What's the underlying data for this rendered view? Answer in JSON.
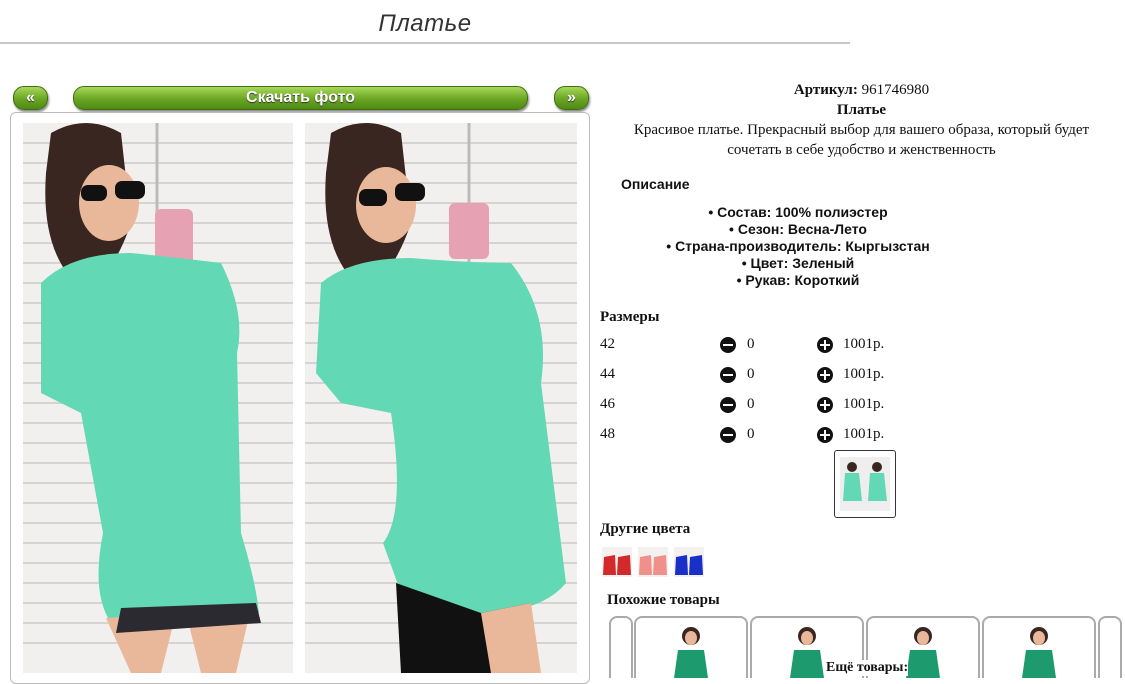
{
  "page": {
    "title": "Платье"
  },
  "nav": {
    "prev_label": "«",
    "download_label": "Скачать фото",
    "next_label": "»"
  },
  "product": {
    "article_label": "Артикул:",
    "article_value": "961746980",
    "name": "Платье",
    "description": "Красивое платье. Прекрасный выбор для вашего образа, который будет сочетать в себе удобство и женственность",
    "specs_title": "Описание",
    "specs": [
      "Состав: 100% полиэстер",
      "Сезон: Весна-Лето",
      "Страна-производитель: Кыргызстан",
      "Цвет: Зеленый",
      "Рукав: Короткий"
    ]
  },
  "sizes": {
    "title": "Размеры",
    "rows": [
      {
        "size": "42",
        "qty": "0",
        "price": "1001р."
      },
      {
        "size": "44",
        "qty": "0",
        "price": "1001р."
      },
      {
        "size": "46",
        "qty": "0",
        "price": "1001р."
      },
      {
        "size": "48",
        "qty": "0",
        "price": "1001р."
      }
    ]
  },
  "other_colors": {
    "title": "Другие цвета",
    "swatches": [
      "#d22a2a",
      "#f0908a",
      "#1a2ec8"
    ]
  },
  "similar": {
    "title": "Похожие товары",
    "more_label": "Ещё товары:"
  },
  "colors": {
    "dress": "#62d9b4",
    "button_green": "#6aa524"
  }
}
